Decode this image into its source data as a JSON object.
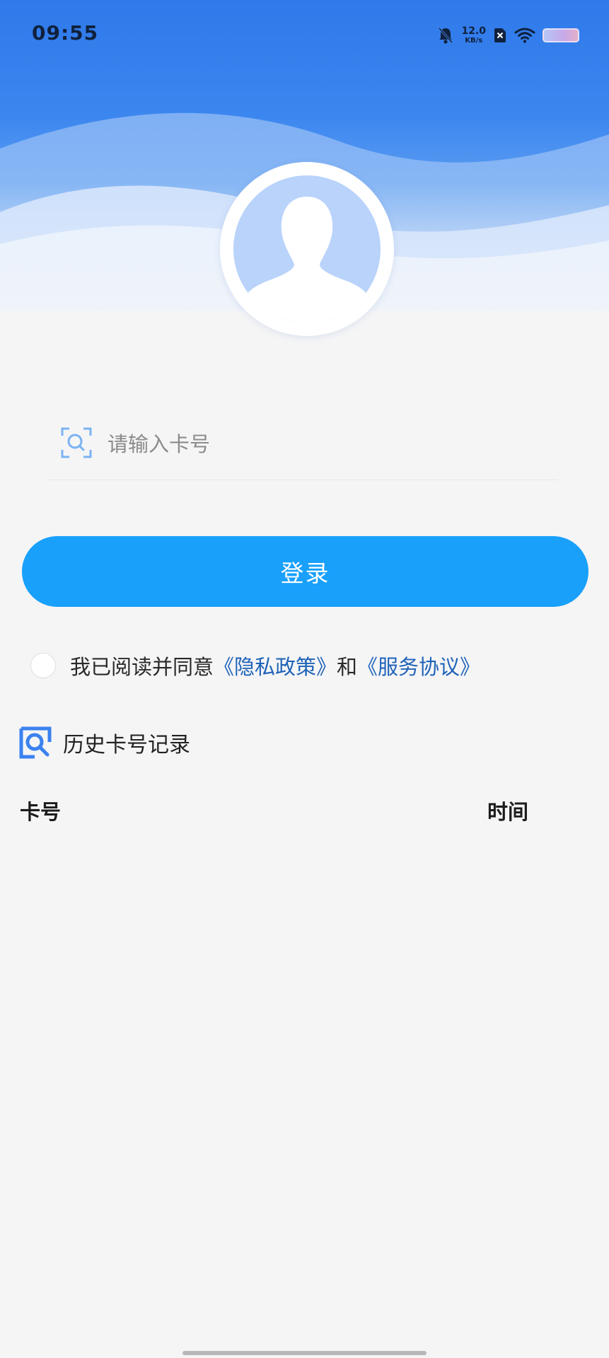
{
  "status_bar": {
    "time": "09:55",
    "net_speed_value": "12.0",
    "net_speed_unit": "KB/s",
    "icons": [
      "bell-muted-icon",
      "sim-x-icon",
      "wifi-icon",
      "battery-icon"
    ]
  },
  "login": {
    "card_input_placeholder": "请输入卡号",
    "card_input_value": "",
    "login_button_label": "登录"
  },
  "agreement": {
    "prefix": "我已阅读并同意",
    "privacy_link": "《隐私政策》",
    "conjunction": "和",
    "service_link": "《服务协议》",
    "checked": false
  },
  "history": {
    "title": "历史卡号记录",
    "columns": [
      "卡号",
      "时间"
    ],
    "rows": []
  },
  "colors": {
    "primary_button": "#18a0fb",
    "link": "#1f63b8",
    "header_blue": "#2f79ea",
    "background": "#f5f5f6",
    "avatar_fill": "#b9d3fb"
  }
}
